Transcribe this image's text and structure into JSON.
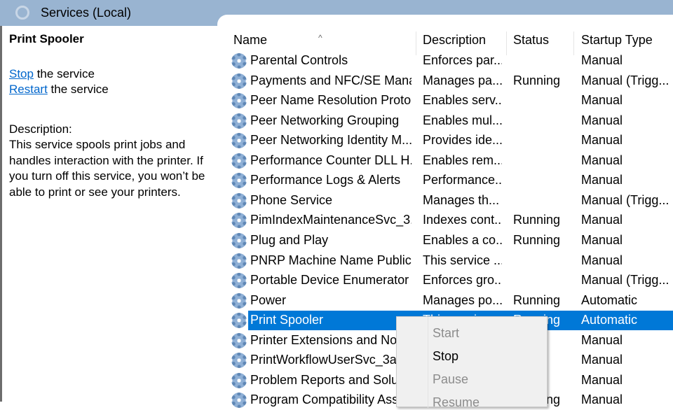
{
  "window": {
    "title": "Services (Local)"
  },
  "left": {
    "service_name": "Print Spooler",
    "stop_link": "Stop",
    "stop_suffix": " the service",
    "restart_link": "Restart",
    "restart_suffix": " the service",
    "description_label": "Description:",
    "description": "This service spools print jobs and handles interaction with the printer. If you turn off this service, you won’t be able to print or see your printers."
  },
  "columns": [
    "Name",
    "Description",
    "Status",
    "Startup Type"
  ],
  "rows": [
    {
      "name": "Parental Controls",
      "description": "Enforces par...",
      "status": "",
      "startup": "Manual"
    },
    {
      "name": "Payments and NFC/SE Mana...",
      "description": "Manages pa...",
      "status": "Running",
      "startup": "Manual (Trigg..."
    },
    {
      "name": "Peer Name Resolution Proto...",
      "description": "Enables serv...",
      "status": "",
      "startup": "Manual"
    },
    {
      "name": "Peer Networking Grouping",
      "description": "Enables mul...",
      "status": "",
      "startup": "Manual"
    },
    {
      "name": "Peer Networking Identity M...",
      "description": "Provides ide...",
      "status": "",
      "startup": "Manual"
    },
    {
      "name": "Performance Counter DLL H...",
      "description": "Enables rem...",
      "status": "",
      "startup": "Manual"
    },
    {
      "name": "Performance Logs & Alerts",
      "description": "Performance...",
      "status": "",
      "startup": "Manual"
    },
    {
      "name": "Phone Service",
      "description": "Manages th...",
      "status": "",
      "startup": "Manual (Trigg..."
    },
    {
      "name": "PimIndexMaintenanceSvc_3...",
      "description": "Indexes cont...",
      "status": "Running",
      "startup": "Manual"
    },
    {
      "name": "Plug and Play",
      "description": "Enables a co...",
      "status": "Running",
      "startup": "Manual"
    },
    {
      "name": "PNRP Machine Name Public...",
      "description": "This service ...",
      "status": "",
      "startup": "Manual"
    },
    {
      "name": "Portable Device Enumerator ...",
      "description": "Enforces gro...",
      "status": "",
      "startup": "Manual (Trigg..."
    },
    {
      "name": "Power",
      "description": "Manages po...",
      "status": "Running",
      "startup": "Automatic"
    },
    {
      "name": "Print Spooler",
      "description": "This service ...",
      "status": "Running",
      "startup": "Automatic"
    },
    {
      "name": "Printer Extensions and Noti...",
      "description": "",
      "status": "",
      "startup": "Manual"
    },
    {
      "name": "PrintWorkflowUserSvc_3a8...",
      "description": "",
      "status": "",
      "startup": "Manual"
    },
    {
      "name": "Problem Reports and Soluti...",
      "description": "",
      "status": "",
      "startup": "Manual"
    },
    {
      "name": "Program Compatibility Assi...",
      "description": "",
      "status": "Running",
      "startup": "Manual"
    }
  ],
  "context_menu": [
    {
      "label": "Start",
      "enabled": false
    },
    {
      "label": "Stop",
      "enabled": true
    },
    {
      "label": "Pause",
      "enabled": false
    },
    {
      "label": "Resume",
      "enabled": false
    }
  ],
  "colors": {
    "header": "#99b4d1",
    "selection": "#0078d7",
    "link": "#0066cc"
  }
}
